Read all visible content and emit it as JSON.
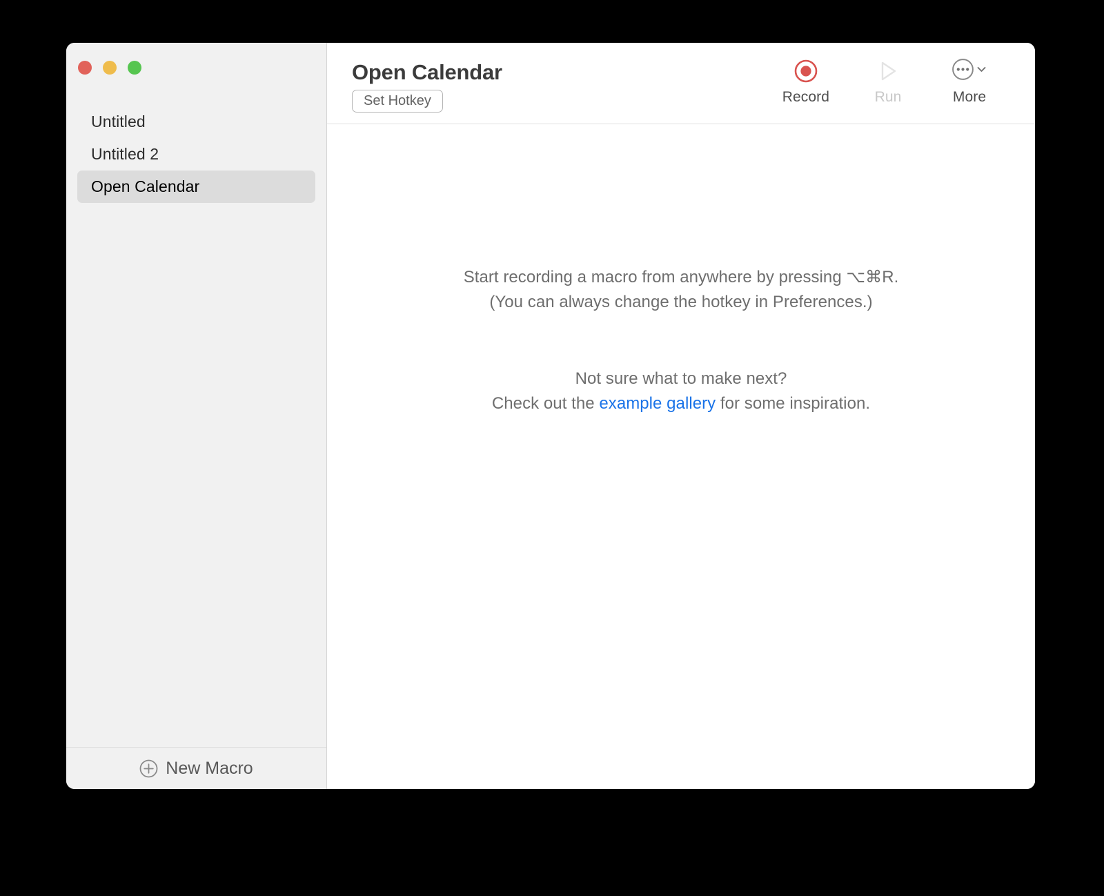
{
  "window": {
    "traffic_lights": [
      {
        "name": "close",
        "color": "#e1625a"
      },
      {
        "name": "minimize",
        "color": "#efbc4c"
      },
      {
        "name": "maximize",
        "color": "#56c550"
      }
    ]
  },
  "sidebar": {
    "items": [
      {
        "label": "Untitled",
        "selected": false
      },
      {
        "label": "Untitled 2",
        "selected": false
      },
      {
        "label": "Open Calendar",
        "selected": true
      }
    ],
    "footer": {
      "new_macro_label": "New Macro",
      "new_macro_icon": "plus-circle-icon"
    }
  },
  "toolbar": {
    "title": "Open Calendar",
    "set_hotkey_label": "Set Hotkey",
    "actions": [
      {
        "label": "Record",
        "icon": "record-icon",
        "enabled": true,
        "color": "#d9534f"
      },
      {
        "label": "Run",
        "icon": "play-icon",
        "enabled": false,
        "color": "#e3e3e3"
      },
      {
        "label": "More",
        "icon": "ellipsis-circle-icon",
        "enabled": true,
        "color": "#808080"
      }
    ]
  },
  "empty_state": {
    "line1": "Start recording a macro from anywhere by pressing ⌥⌘R.",
    "line2": "(You can always change the hotkey in Preferences.)",
    "line3": "Not sure what to make next?",
    "line4_prefix": "Check out the ",
    "link_text": "example gallery",
    "line4_suffix": " for some inspiration.",
    "link_color": "#1a73e8"
  }
}
